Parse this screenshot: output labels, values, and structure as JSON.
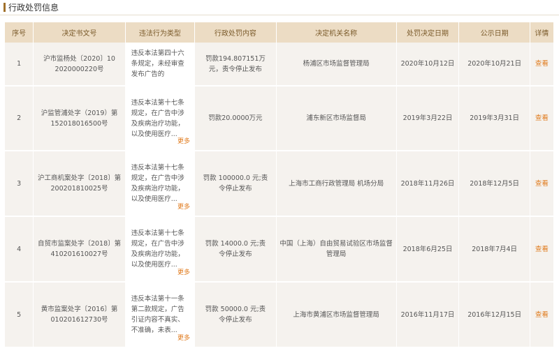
{
  "section_title": "行政处罚信息",
  "columns": [
    "序号",
    "决定书文号",
    "违法行为类型",
    "行政处罚内容",
    "决定机关名称",
    "处罚决定日期",
    "公示日期",
    "详情"
  ],
  "rows": [
    {
      "no": "1",
      "doc_no": "沪市监杨处〔2020〕10 2020000220号",
      "behavior": "违反本法第四十六条规定，未经审查发布广告的",
      "more": "",
      "content": "罚款194.807151万元，责令停止发布",
      "authority": "杨浦区市场监督管理局",
      "decision_date": "2020年10月12日",
      "publish_date": "2020年10月21日",
      "view": "查看"
    },
    {
      "no": "2",
      "doc_no": "沪监管浦处字（2019）第152018016500号",
      "behavior": "违反本法第十七条规定，在广告中涉及疾病治疗功能，以及使用医疗...",
      "more": "更多",
      "content": "罚款20.0000万元",
      "authority": "浦东新区市场监督局",
      "decision_date": "2019年3月22日",
      "publish_date": "2019年3月31日",
      "view": "查看"
    },
    {
      "no": "3",
      "doc_no": "沪工商机案处字〔2018〕第200201810025号",
      "behavior": "违反本法第十七条规定，在广告中涉及疾病治疗功能，以及使用医疗...",
      "more": "更多",
      "content": "罚款 100000.0 元;责令停止发布",
      "authority": "上海市工商行政管理局 机场分局",
      "decision_date": "2018年11月26日",
      "publish_date": "2018年12月5日",
      "view": "查看"
    },
    {
      "no": "4",
      "doc_no": "自贸市监案处字〔2018〕第410201610027号",
      "behavior": "违反本法第十七条规定，在广告中涉及疾病治疗功能，以及使用医疗...",
      "more": "更多",
      "content": "罚款 14000.0 元;责令停止发布",
      "authority": "中国（上海）自由贸易试验区市场监督管理局",
      "decision_date": "2018年6月25日",
      "publish_date": "2018年7月4日",
      "view": "查看"
    },
    {
      "no": "5",
      "doc_no": "黄市监案处字〔2016〕第010201612730号",
      "behavior": "违反本法第十一条第二款规定，广告引证内容不真实、不准确，未表...",
      "more": "更多",
      "content": "罚款 50000.0 元;责令停止发布",
      "authority": "上海市黄浦区市场监督管理局",
      "decision_date": "2016年11月17日",
      "publish_date": "2016年12月15日",
      "view": "查看"
    }
  ]
}
